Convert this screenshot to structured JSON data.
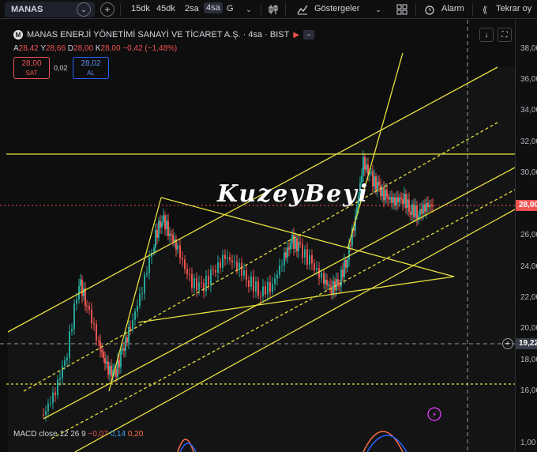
{
  "toolbar": {
    "symbol": "MANAS",
    "timeframes": [
      "15dk",
      "45dk",
      "2sa",
      "4sa",
      "G"
    ],
    "active_timeframe": "4sa",
    "indicators_label": "Göstergeler",
    "alarm_label": "Alarm",
    "replay_label": "Tekrar oy"
  },
  "legend": {
    "title": "MANAS ENERJİ YÖNETİMİ SANAYİ VE TİCARET A.Ş. · 4sa · BIST",
    "logo_letter": "M",
    "ohlc": {
      "o_label": "A",
      "o": "28,42",
      "h_label": "Y",
      "h": "28,66",
      "l_label": "D",
      "l": "28,00",
      "c_label": "K",
      "c": "28,00",
      "change": "−0,42 (−1,48%)"
    },
    "sell_price": "28,00",
    "sell_label": "SAT",
    "spread": "0,02",
    "buy_price": "28,02",
    "buy_label": "AL"
  },
  "watermark": "KuzeyBeyi",
  "macd": {
    "label": "MACD close 12 26 9",
    "v1": "−0,07",
    "v2": "0,14",
    "v3": "0,20"
  },
  "price_axis": {
    "labels": [
      "38,00",
      "36,00",
      "34,00",
      "32,00",
      "30,00",
      "26,00",
      "24,00",
      "22,00",
      "20,00",
      "18,00",
      "16,00",
      "1,00"
    ],
    "current_price": "28,00",
    "crosshair_price": "19,22"
  },
  "colors": {
    "up": "#26a69a",
    "down": "#ef5350",
    "drawing": "#e8e040",
    "background": "#0e0e0e"
  },
  "chart_data": {
    "type": "candlestick",
    "ylim": [
      14.5,
      38.5
    ],
    "current_price": 28.0,
    "crosshair_price": 19.22,
    "horizontal_levels": [
      31.3,
      16.5
    ]
  }
}
